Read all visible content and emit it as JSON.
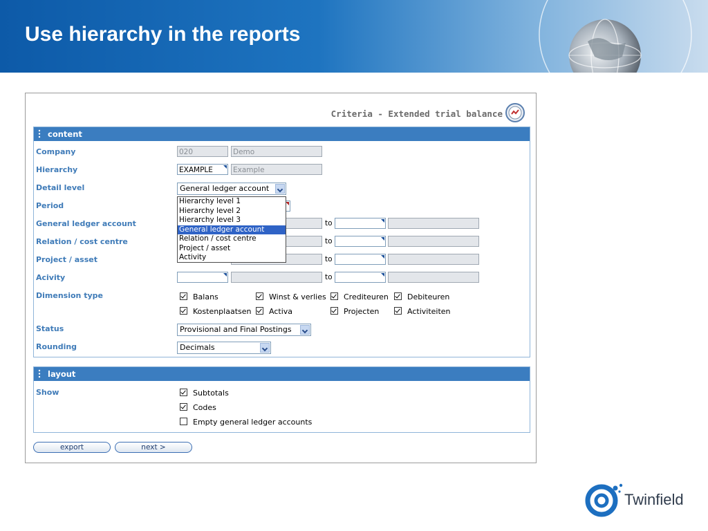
{
  "slide": {
    "title": "Use hierarchy in the reports"
  },
  "window": {
    "title": "Criteria - Extended trial balance"
  },
  "content": {
    "header": "content",
    "labels": {
      "company": "Company",
      "hierarchy": "Hierarchy",
      "detail_level": "Detail level",
      "period": "Period",
      "general_ledger_account": "General ledger account",
      "relation_cost_centre": "Relation / cost centre",
      "project_asset": "Project / asset",
      "activity": "Acivity",
      "dimension_type": "Dimension type",
      "status": "Status",
      "rounding": "Rounding"
    },
    "company_code": "020",
    "company_name": "Demo",
    "hierarchy_code": "EXAMPLE",
    "hierarchy_name": "Example",
    "detail_level_value": "General ledger account",
    "detail_level_options": [
      "Hierarchy level 1",
      "Hierarchy level 2",
      "Hierarchy level 3",
      "General ledger account",
      "Relation / cost centre",
      "Project / asset",
      "Activity"
    ],
    "to_label": "to",
    "dimension_types": [
      {
        "label": "Balans",
        "checked": true
      },
      {
        "label": "Winst & verlies",
        "checked": true
      },
      {
        "label": "Crediteuren",
        "checked": true
      },
      {
        "label": "Debiteuren",
        "checked": true
      },
      {
        "label": "Kostenplaatsen",
        "checked": true
      },
      {
        "label": "Activa",
        "checked": true
      },
      {
        "label": "Projecten",
        "checked": true
      },
      {
        "label": "Activiteiten",
        "checked": true
      }
    ],
    "status_value": "Provisional and Final Postings",
    "rounding_value": "Decimals"
  },
  "layout_section": {
    "header": "layout",
    "show_label": "Show",
    "options": [
      {
        "label": "Subtotals",
        "checked": true
      },
      {
        "label": "Codes",
        "checked": true
      },
      {
        "label": "Empty general ledger accounts",
        "checked": false
      }
    ]
  },
  "buttons": {
    "export": "export",
    "next": "next >"
  },
  "brand": {
    "name": "Twinfield"
  },
  "colors": {
    "accent": "#3b7dc0",
    "label": "#3f7bb8",
    "highlight": "#2f63c6"
  }
}
